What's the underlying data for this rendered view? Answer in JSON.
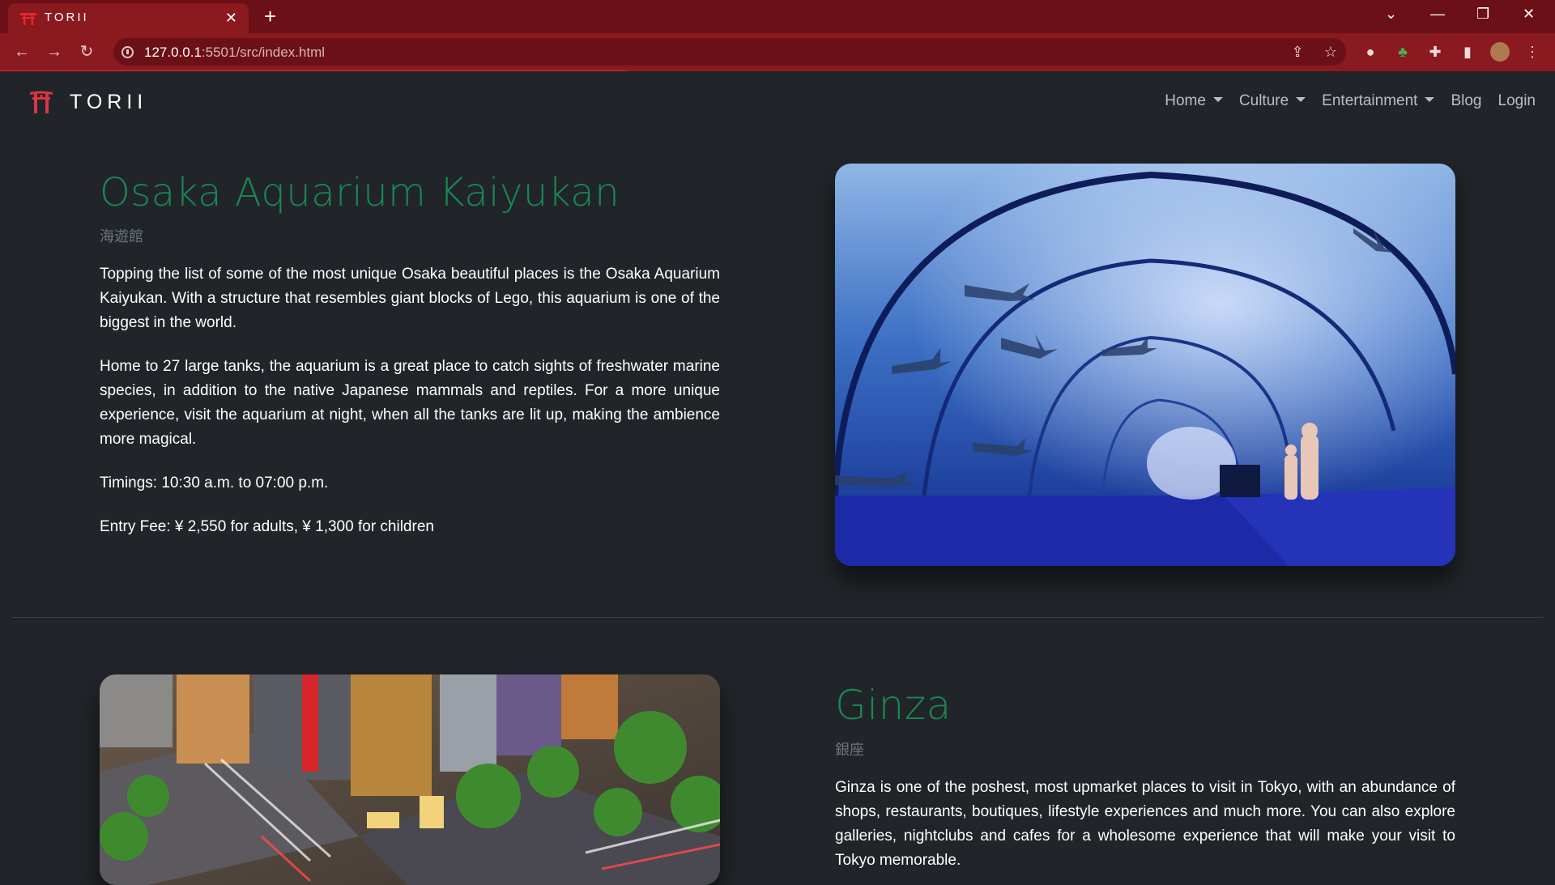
{
  "browser": {
    "tab_title": "TORII",
    "url_host": "127.0.0.1",
    "url_rest": ":5501/src/index.html"
  },
  "navbar": {
    "brand": "TORII",
    "links": [
      {
        "label": "Home",
        "dropdown": true
      },
      {
        "label": "Culture",
        "dropdown": true
      },
      {
        "label": "Entertainment",
        "dropdown": true
      },
      {
        "label": "Blog",
        "dropdown": false
      },
      {
        "label": "Login",
        "dropdown": false
      }
    ]
  },
  "sections": [
    {
      "title": "Osaka Aquarium Kaiyukan",
      "subtitle": "海遊館",
      "paragraphs": [
        "Topping the list of some of the most unique Osaka beautiful places is the Osaka Aquarium Kaiyukan. With a structure that resembles giant blocks of Lego, this aquarium is one of the biggest in the world.",
        "Home to 27 large tanks, the aquarium is a great place to catch sights of freshwater marine species, in addition to the native Japanese mammals and reptiles. For a more unique experience, visit the aquarium at night, when all the tanks are lit up, making the ambience more magical.",
        "Timings: 10:30 a.m. to 07:00 p.m.",
        "Entry Fee: ¥ 2,550 for adults, ¥ 1,300 for children"
      ]
    },
    {
      "title": "Ginza",
      "subtitle": "銀座",
      "paragraphs": [
        "Ginza is one of the poshest, most upmarket places to visit in Tokyo, with an abundance of shops, restaurants, boutiques, lifestyle experiences and much more. You can also explore galleries, nightclubs and cafes for a wholesome experience that will make your visit to Tokyo memorable."
      ]
    }
  ],
  "colors": {
    "title_green": "#198754",
    "page_bg": "#212529",
    "browser_red": "#8a1a1f"
  }
}
